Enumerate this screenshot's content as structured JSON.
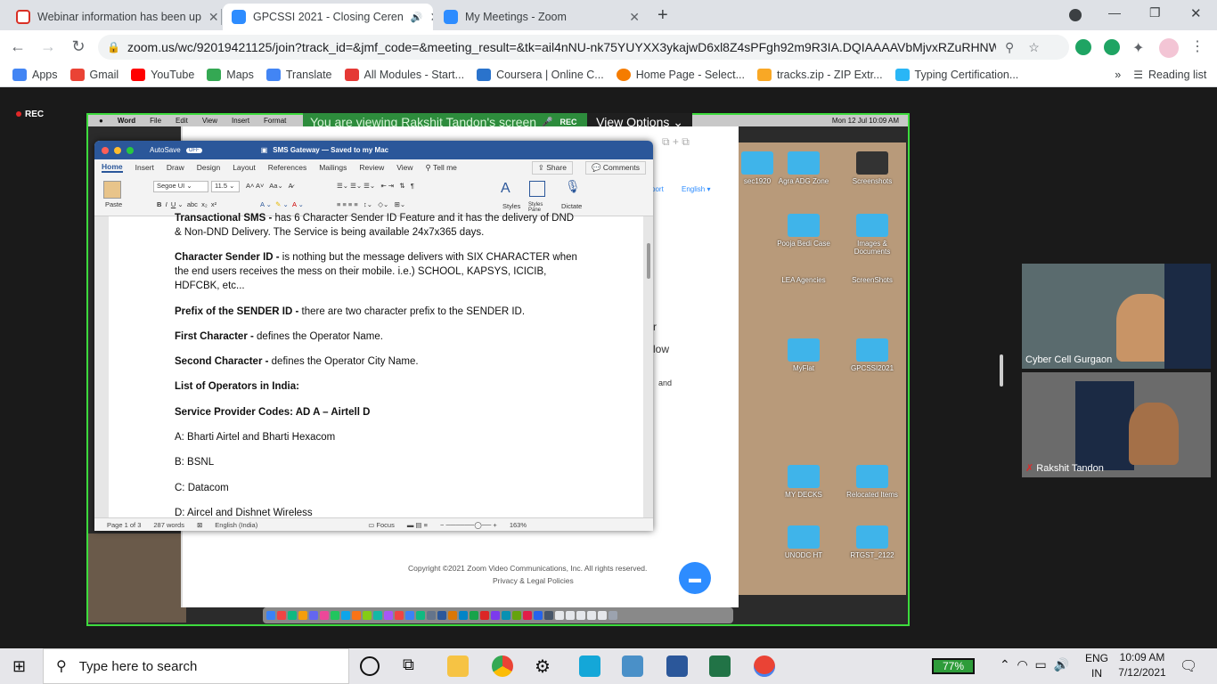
{
  "browser": {
    "tabs": [
      {
        "title": "Webinar information has been up",
        "color": "#d93025"
      },
      {
        "title": "GPCSSI 2021 - Closing Ceren",
        "color": "#2d8cff"
      },
      {
        "title": "My Meetings - Zoom",
        "color": "#2d8cff"
      }
    ],
    "new_tab": "+",
    "url": "zoom.us/wc/92019421125/join?track_id=&jmf_code=&meeting_result=&tk=ail4nNU-nk75YUYXX3ykajwD6xl8Z4sPFgh92m9R3IA.DQIAAAAVbMjvxRZuRHNW...",
    "bookmarks": [
      {
        "label": "Apps"
      },
      {
        "label": "Gmail"
      },
      {
        "label": "YouTube"
      },
      {
        "label": "Maps"
      },
      {
        "label": "Translate"
      },
      {
        "label": "All Modules - Start..."
      },
      {
        "label": "Coursera | Online C..."
      },
      {
        "label": "Home Page - Select..."
      },
      {
        "label": "tracks.zip - ZIP Extr..."
      },
      {
        "label": "Typing Certification..."
      }
    ],
    "more": "»",
    "reading_list": "Reading list"
  },
  "zoom": {
    "rec_label": "REC",
    "viewing_text": "You are viewing Rakshit Tandon's screen",
    "view_options": "View Options",
    "footer_copyright": "Copyright ©2021 Zoom Video Communications, Inc. All rights reserved.",
    "footer_links": "Privacy & Legal Policies",
    "participants": [
      {
        "name": "Cyber Cell Gurgaon"
      },
      {
        "name": "Rakshit Tandon"
      }
    ]
  },
  "mac": {
    "menu": [
      "Word",
      "File",
      "Edit",
      "View",
      "Insert",
      "Format"
    ],
    "clock": "Mon 12 Jul  10:09 AM",
    "desktop_icons": [
      "sec1920",
      "Agra ADG Zone",
      "Screenshots",
      "Pooja Bedi Case",
      "Images & Documents",
      "LEA Agencies",
      "ScreenShots",
      "MyFlat",
      "GPCSSI2021",
      "MY DECKS",
      "Relocated Items",
      "UNODC HT",
      "RTGST_2122"
    ]
  },
  "word": {
    "title": "SMS Gateway — Saved to my Mac",
    "autosave": "AutoSave",
    "autosave_state": "OFF",
    "tabs": [
      "Home",
      "Insert",
      "Draw",
      "Design",
      "Layout",
      "References",
      "Mailings",
      "Review",
      "View",
      "Tell me"
    ],
    "share": "Share",
    "comments": "Comments",
    "font": "Segoe UI",
    "size": "11.5",
    "paste": "Paste",
    "styles": "Styles",
    "styles_pane": "Styles Pane",
    "dictate": "Dictate",
    "doc": {
      "p0_bold": "Transactional SMS -",
      "p0": " has 6 Character Sender ID Feature and it has the delivery of DND & Non-DND Delivery. The Service is being available 24x7x365 days.",
      "p1_bold": "Character Sender ID -",
      "p1": " is nothing but the message delivers with SIX CHARACTER when the end users receives the mess on their mobile. i.e.) SCHOOL, KAPSYS, ICICIB, HDFCBK, etc...",
      "p2_bold": "Prefix of the SENDER ID -",
      "p2": " there are two character prefix to the SENDER ID.",
      "p3_bold": "First Character -",
      "p3": " defines the Operator Name.",
      "p4_bold": "Second Character -",
      "p4": " defines the Operator City Name.",
      "p5_bold": "List of Operators in India:",
      "p6_bold": "Service Provider Codes: AD A – Airtell D",
      "p7": "A: Bharti Airtel and Bharti Hexacom",
      "p8": "B: BSNL",
      "p9": "C: Datacom",
      "p10": "D: Aircel and Dishnet Wireless"
    },
    "status": {
      "page": "Page 1 of 3",
      "words": "287 words",
      "language": "English (India)",
      "focus": "Focus",
      "zoom": "163%"
    }
  },
  "zoom_page_partial": {
    "support": "port",
    "language": "English",
    "and": "and",
    "low": "low",
    "r": "r"
  },
  "taskbar": {
    "search_placeholder": "Type here to search",
    "battery": "77%",
    "lang1": "ENG",
    "lang2": "IN",
    "time": "10:09 AM",
    "date": "7/12/2021"
  }
}
